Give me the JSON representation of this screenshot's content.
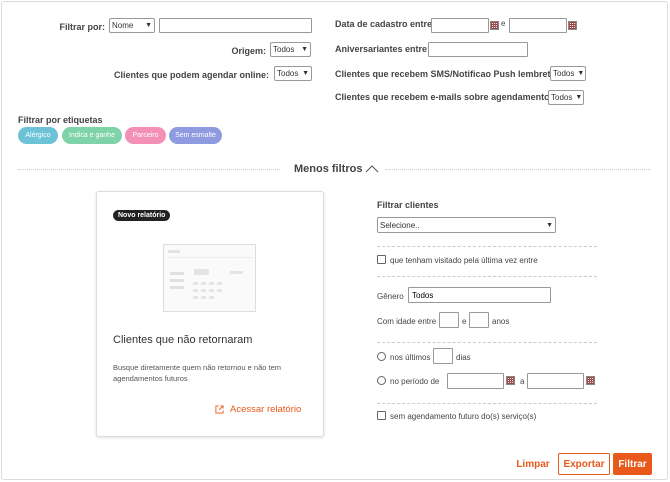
{
  "filters": {
    "filter_by_label": "Filtrar por:",
    "filter_by_select": "Nome",
    "filter_by_value": "",
    "origin_label": "Origem:",
    "origin_select": "Todos",
    "online_label": "Clientes que podem agendar online:",
    "online_select": "Todos",
    "signup_label": "Data de cadastro entre",
    "signup_and": "e",
    "birthday_label": "Aniversariantes entre:",
    "sms_label": "Clientes que recebem SMS/Notificao Push lembrete:",
    "sms_select": "Todos",
    "email_label": "Clientes que recebem e-mails sobre agendamentos:",
    "email_select": "Todos"
  },
  "tags": {
    "title": "Filtrar por etiquetas",
    "items": [
      {
        "label": "Alérgico",
        "color": "#6cc3d8"
      },
      {
        "label": "Indica e ganhe",
        "color": "#7fd3a8"
      },
      {
        "label": "Parceiro",
        "color": "#f48fb6"
      },
      {
        "label": "Sem esmalte",
        "color": "#8e9be0"
      }
    ]
  },
  "toggle": {
    "label": "Menos filtros",
    "icon": "chevron-up-icon"
  },
  "report_card": {
    "badge": "Novo relatório",
    "title": "Clientes que não retornaram",
    "description": "Busque diretamente quem não retornou e não tem agendamentos futuros",
    "link": "Acessar relatório",
    "link_icon": "external-link-icon"
  },
  "client_filter": {
    "title": "Filtrar clientes",
    "select_placeholder": "Selecione..",
    "visited_label": "que tenham visitado pela última vez entre",
    "gender_label": "Gênero",
    "gender_value": "Todos",
    "age_label": "Com idade entre",
    "age_and": "e",
    "age_unit": "anos",
    "last_label": "nos últimos",
    "last_unit": "dias",
    "period_label": "no período de",
    "period_and": "a",
    "no_future_label": "sem agendamento futuro do(s) serviço(s)"
  },
  "actions": {
    "clear": "Limpar",
    "export": "Exportar",
    "filter": "Filtrar"
  },
  "colors": {
    "accent": "#e8591a",
    "text": "#333333"
  }
}
